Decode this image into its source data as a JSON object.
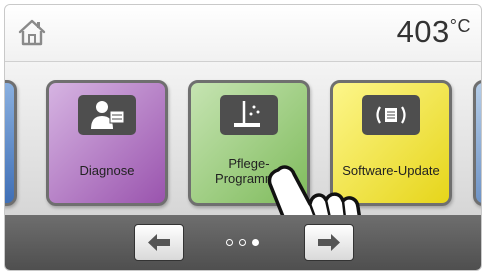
{
  "header": {
    "home_icon": "house-icon",
    "temperature": "403",
    "temperature_unit": "°C"
  },
  "tiles": [
    {
      "label": "",
      "icon": "unknown-icon",
      "color": "#4a7bc2"
    },
    {
      "label": "Diagnose",
      "icon": "technician-icon",
      "color": "#b77cc9"
    },
    {
      "label": "Pflege-\nProgramme",
      "icon": "cleaning-icon",
      "color": "#9ccc7e"
    },
    {
      "label": "Software-Update",
      "icon": "chip-icon",
      "color": "#f3e940"
    },
    {
      "label": "",
      "icon": "unknown-icon",
      "color": "#8fb0da"
    }
  ],
  "navigation": {
    "prev_icon": "arrow-left-icon",
    "next_icon": "arrow-right-icon",
    "page_count": 3,
    "active_page": 3
  },
  "overlay": {
    "icon": "pointing-hand-icon"
  }
}
